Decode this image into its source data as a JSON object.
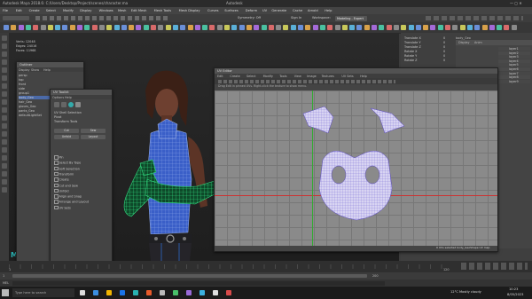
{
  "app": {
    "window_title": "Autodesk Maya 2018.6: C:/Users/Desktop/Project/scenes/character.ma",
    "window_title_right": "Autodesk",
    "menus": [
      "File",
      "Edit",
      "Create",
      "Select",
      "Modify",
      "Display",
      "Windows",
      "Mesh",
      "Edit Mesh",
      "Mesh Tools",
      "Mesh Display",
      "Curves",
      "Surfaces",
      "Deform",
      "UV",
      "Generate",
      "Cache",
      "Arnold",
      "Help"
    ],
    "workspace_label": "Workspace:",
    "workspace_value": "Modeling - Expert",
    "symmetry_label": "Symmetry: Off",
    "signin_label": "Sign In"
  },
  "outliner": {
    "title": "Outliner",
    "menu": [
      "Display",
      "Show",
      "Help"
    ],
    "items": [
      "persp",
      "top",
      "front",
      "side",
      "group1",
      "body_Geo",
      "hair_Geo",
      "gloves_Geo",
      "pants_Geo",
      "defaultLightSet"
    ]
  },
  "uv_toolkit": {
    "title": "UV Toolkit",
    "menu": [
      "Options",
      "Help"
    ],
    "sections": [
      "Pin",
      "Select By Type",
      "Soft Selection",
      "Transform",
      "Create",
      "Cut and Sew",
      "Unfold",
      "Align and Snap",
      "Arrange and Layout",
      "UV Sets"
    ],
    "rows": [
      "UV Shell Selection",
      "Pivot",
      "Transform Tools"
    ],
    "buttons": [
      "Cut",
      "Sew",
      "Unfold",
      "Layout"
    ]
  },
  "uv_editor": {
    "title": "UV Editor",
    "menu": [
      "Edit",
      "Create",
      "Select",
      "Modify",
      "Tools",
      "View",
      "Image",
      "Textures",
      "UV Sets",
      "Help"
    ],
    "hint": "Drag Edit in pinned UVs. Right-click the texture to show menu.",
    "status": "0 UVs selected  body_GeoShape UV map"
  },
  "channel_box": {
    "object": "body_Geo",
    "attributes": [
      {
        "name": "Translate X",
        "value": "0"
      },
      {
        "name": "Translate Y",
        "value": "0"
      },
      {
        "name": "Translate Z",
        "value": "0"
      },
      {
        "name": "Rotate X",
        "value": "0"
      },
      {
        "name": "Rotate Y",
        "value": "0"
      },
      {
        "name": "Rotate Z",
        "value": "0"
      }
    ],
    "tabs": [
      "Channels",
      "Edit",
      "Object",
      "Show"
    ]
  },
  "layer_editor": {
    "tabs": [
      "Display",
      "Anim"
    ],
    "layers": [
      "layer1",
      "layer2",
      "layer3",
      "layer4",
      "layer5",
      "layer6",
      "layer7",
      "layer8",
      "layer9"
    ]
  },
  "viewport_hud": {
    "verts_label": "Verts:",
    "verts_value": "12048",
    "edges_label": "Edges:",
    "edges_value": "24016",
    "faces_label": "Faces:",
    "faces_value": "11968",
    "camera": "persp"
  },
  "timeline": {
    "start": "1",
    "end": "120",
    "current": "1",
    "range_start": "1",
    "range_end": "200"
  },
  "command_line": {
    "label": "MEL",
    "placeholder": ""
  },
  "taskbar": {
    "search_placeholder": "Type here to search",
    "weather": "12°C Mostly cloudy",
    "time": "10:23",
    "date": "8/05/2023"
  },
  "colors": {
    "accent_blue": "#4b7bd9",
    "wire_green": "#29d67a",
    "uv_wire": "#7a6ad8",
    "maya_teal": "#29b2b2"
  }
}
